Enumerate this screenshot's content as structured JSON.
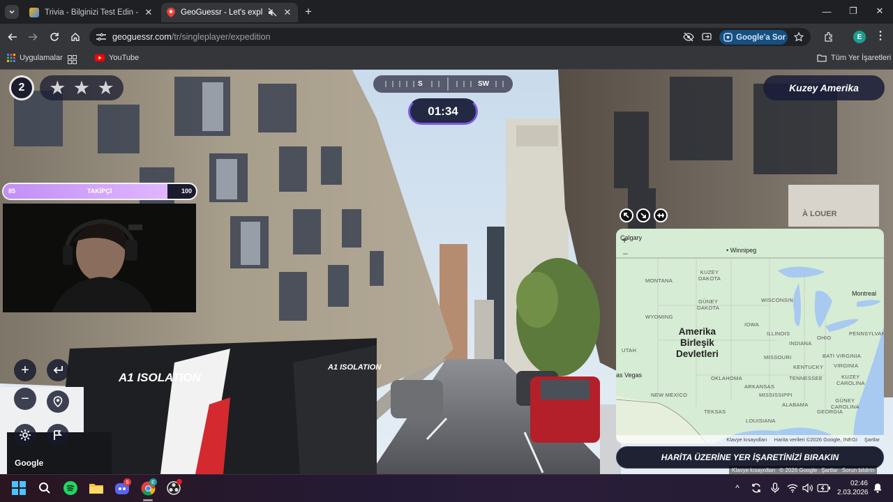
{
  "tabs": [
    {
      "title": "Trivia - Bilginizi Test Edin - Quiz",
      "active": false
    },
    {
      "title": "GeoGuessr - Let's explore the world!",
      "active": true
    }
  ],
  "address": {
    "domain": "geoguessr.com",
    "path": "/tr/singleplayer/expedition"
  },
  "toolbar": {
    "ask_google": "Google'a Sor",
    "profile_initial": "E"
  },
  "bookmarks": {
    "apps": "Uygulamalar",
    "youtube": "YouTube",
    "all_bookmarks": "Tüm Yer İşaretleri"
  },
  "game": {
    "round": "2",
    "stars_total": 3,
    "compass": {
      "s": "S",
      "sw": "SW"
    },
    "timer": "01:34",
    "region": "Kuzey Amerika",
    "follower_bar": {
      "min": "85",
      "label": "TAKİPÇİ",
      "max": "100",
      "progress": 0.85
    },
    "google_logo": "Google",
    "guess_button": "HARİTA ÜZERİNE YER İŞARETİNİZİ BIRAKIN",
    "street_attribution": [
      "Klavye kısayolları",
      "© 2026 Google",
      "Şartlar",
      "Sorun bildirin"
    ],
    "truck_text": [
      "A1 ISOLATION",
      "A1 ISOLATION"
    ],
    "shop_sign": "À LOUER"
  },
  "map": {
    "country": "Amerika\nBirleşik\nDevletleri",
    "cities": {
      "winnipeg": "Winnipeg",
      "montreal": "Montreal",
      "calgary": "Calgary",
      "las_vegas": "as Vegas"
    },
    "states": [
      {
        "k": "montana",
        "t": "MONTANA"
      },
      {
        "k": "north_dakota",
        "t": "KUZEY\nDAKOTA"
      },
      {
        "k": "south_dakota",
        "t": "GÜNEY\nDAKOTA"
      },
      {
        "k": "wyoming",
        "t": "WYOMING"
      },
      {
        "k": "wisconsin",
        "t": "WISCONSIN"
      },
      {
        "k": "iowa",
        "t": "IOWA"
      },
      {
        "k": "illinois",
        "t": "ILLINOIS"
      },
      {
        "k": "ohio",
        "t": "OHIO"
      },
      {
        "k": "pennsylvania",
        "t": "PENNSYLVANIA"
      },
      {
        "k": "indiana",
        "t": "INDIANA"
      },
      {
        "k": "utah",
        "t": "UTAH"
      },
      {
        "k": "missouri",
        "t": "MISSOURI"
      },
      {
        "k": "west_virginia",
        "t": "BATI VIRGINIA"
      },
      {
        "k": "kentucky",
        "t": "KENTUCKY"
      },
      {
        "k": "virginia",
        "t": "VIRGINIA"
      },
      {
        "k": "oklahoma",
        "t": "OKLAHOMA"
      },
      {
        "k": "tennessee",
        "t": "TENNESSEE"
      },
      {
        "k": "north_carolina",
        "t": "KUZEY\nCAROLINA"
      },
      {
        "k": "arkansas",
        "t": "ARKANSAS"
      },
      {
        "k": "new_mexico",
        "t": "NEW MEXİCO"
      },
      {
        "k": "mississippi",
        "t": "MISSISSIPPI"
      },
      {
        "k": "south_carolina",
        "t": "GÜNEY\nCAROLINA"
      },
      {
        "k": "alabama",
        "t": "ALABAMA"
      },
      {
        "k": "georgia",
        "t": "GEORGIA"
      },
      {
        "k": "texas",
        "t": "TEKSAS"
      },
      {
        "k": "louisiana",
        "t": "LOUISIANA"
      }
    ],
    "attribution": [
      "Klavye kısayolları",
      "Harita verileri ©2026 Google, INEGI",
      "Şartlar"
    ]
  },
  "taskbar": {
    "time": "02:46",
    "date": "2.03.2026",
    "discord_badge": "9",
    "chrome_badge": "E"
  },
  "colors": {
    "accent_purple": "#7a58e0",
    "follower_bar": "#d3a6ff",
    "ask_google_bg": "#164f80",
    "map_land": "#d3ebd2",
    "map_water": "#a8c9f0"
  }
}
